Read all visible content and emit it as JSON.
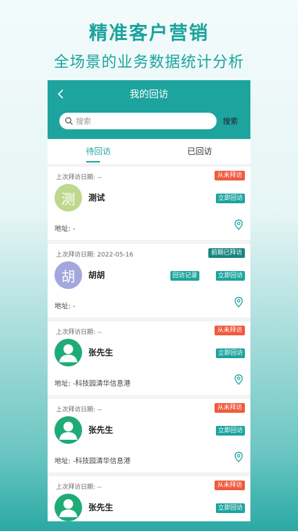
{
  "promo": {
    "title": "精准客户营销",
    "subtitle": "全场景的业务数据统计分析"
  },
  "header": {
    "title": "我的回访",
    "back_icon": "chevron-left-icon"
  },
  "search": {
    "placeholder": "搜索",
    "button_label": "搜索",
    "icon": "search-icon"
  },
  "tabs": [
    {
      "label": "待回访",
      "active": true
    },
    {
      "label": "已回访",
      "active": false
    }
  ],
  "colors": {
    "brand": "#1da49e",
    "badge_never": "#ef5b3f",
    "badge_prev": "#17857f"
  },
  "cards": [
    {
      "date_label": "上次拜访日期:  --",
      "status": "从未拜访",
      "avatar_char": "测",
      "name": "测试",
      "record_button": "",
      "visit_button": "立即回访",
      "address": "地址:  -"
    },
    {
      "date_label": "上次拜访日期:  2022-05-16",
      "status": "前期已拜访",
      "avatar_char": "胡",
      "name": "胡胡",
      "record_button": "回访记录",
      "visit_button": "立即回访",
      "address": "地址:  -"
    },
    {
      "date_label": "上次拜访日期:  --",
      "status": "从未拜访",
      "avatar_char": "",
      "name": "张先生",
      "record_button": "",
      "visit_button": "立即回访",
      "address": "地址:  -科技园清华信息港"
    },
    {
      "date_label": "上次拜访日期:  --",
      "status": "从未拜访",
      "avatar_char": "",
      "name": "张先生",
      "record_button": "",
      "visit_button": "立即回访",
      "address": "地址:  -科技园清华信息港"
    },
    {
      "date_label": "上次拜访日期:  --",
      "status": "从未拜访",
      "avatar_char": "",
      "name": "张先生",
      "record_button": "",
      "visit_button": "立即回访",
      "address": ""
    }
  ]
}
